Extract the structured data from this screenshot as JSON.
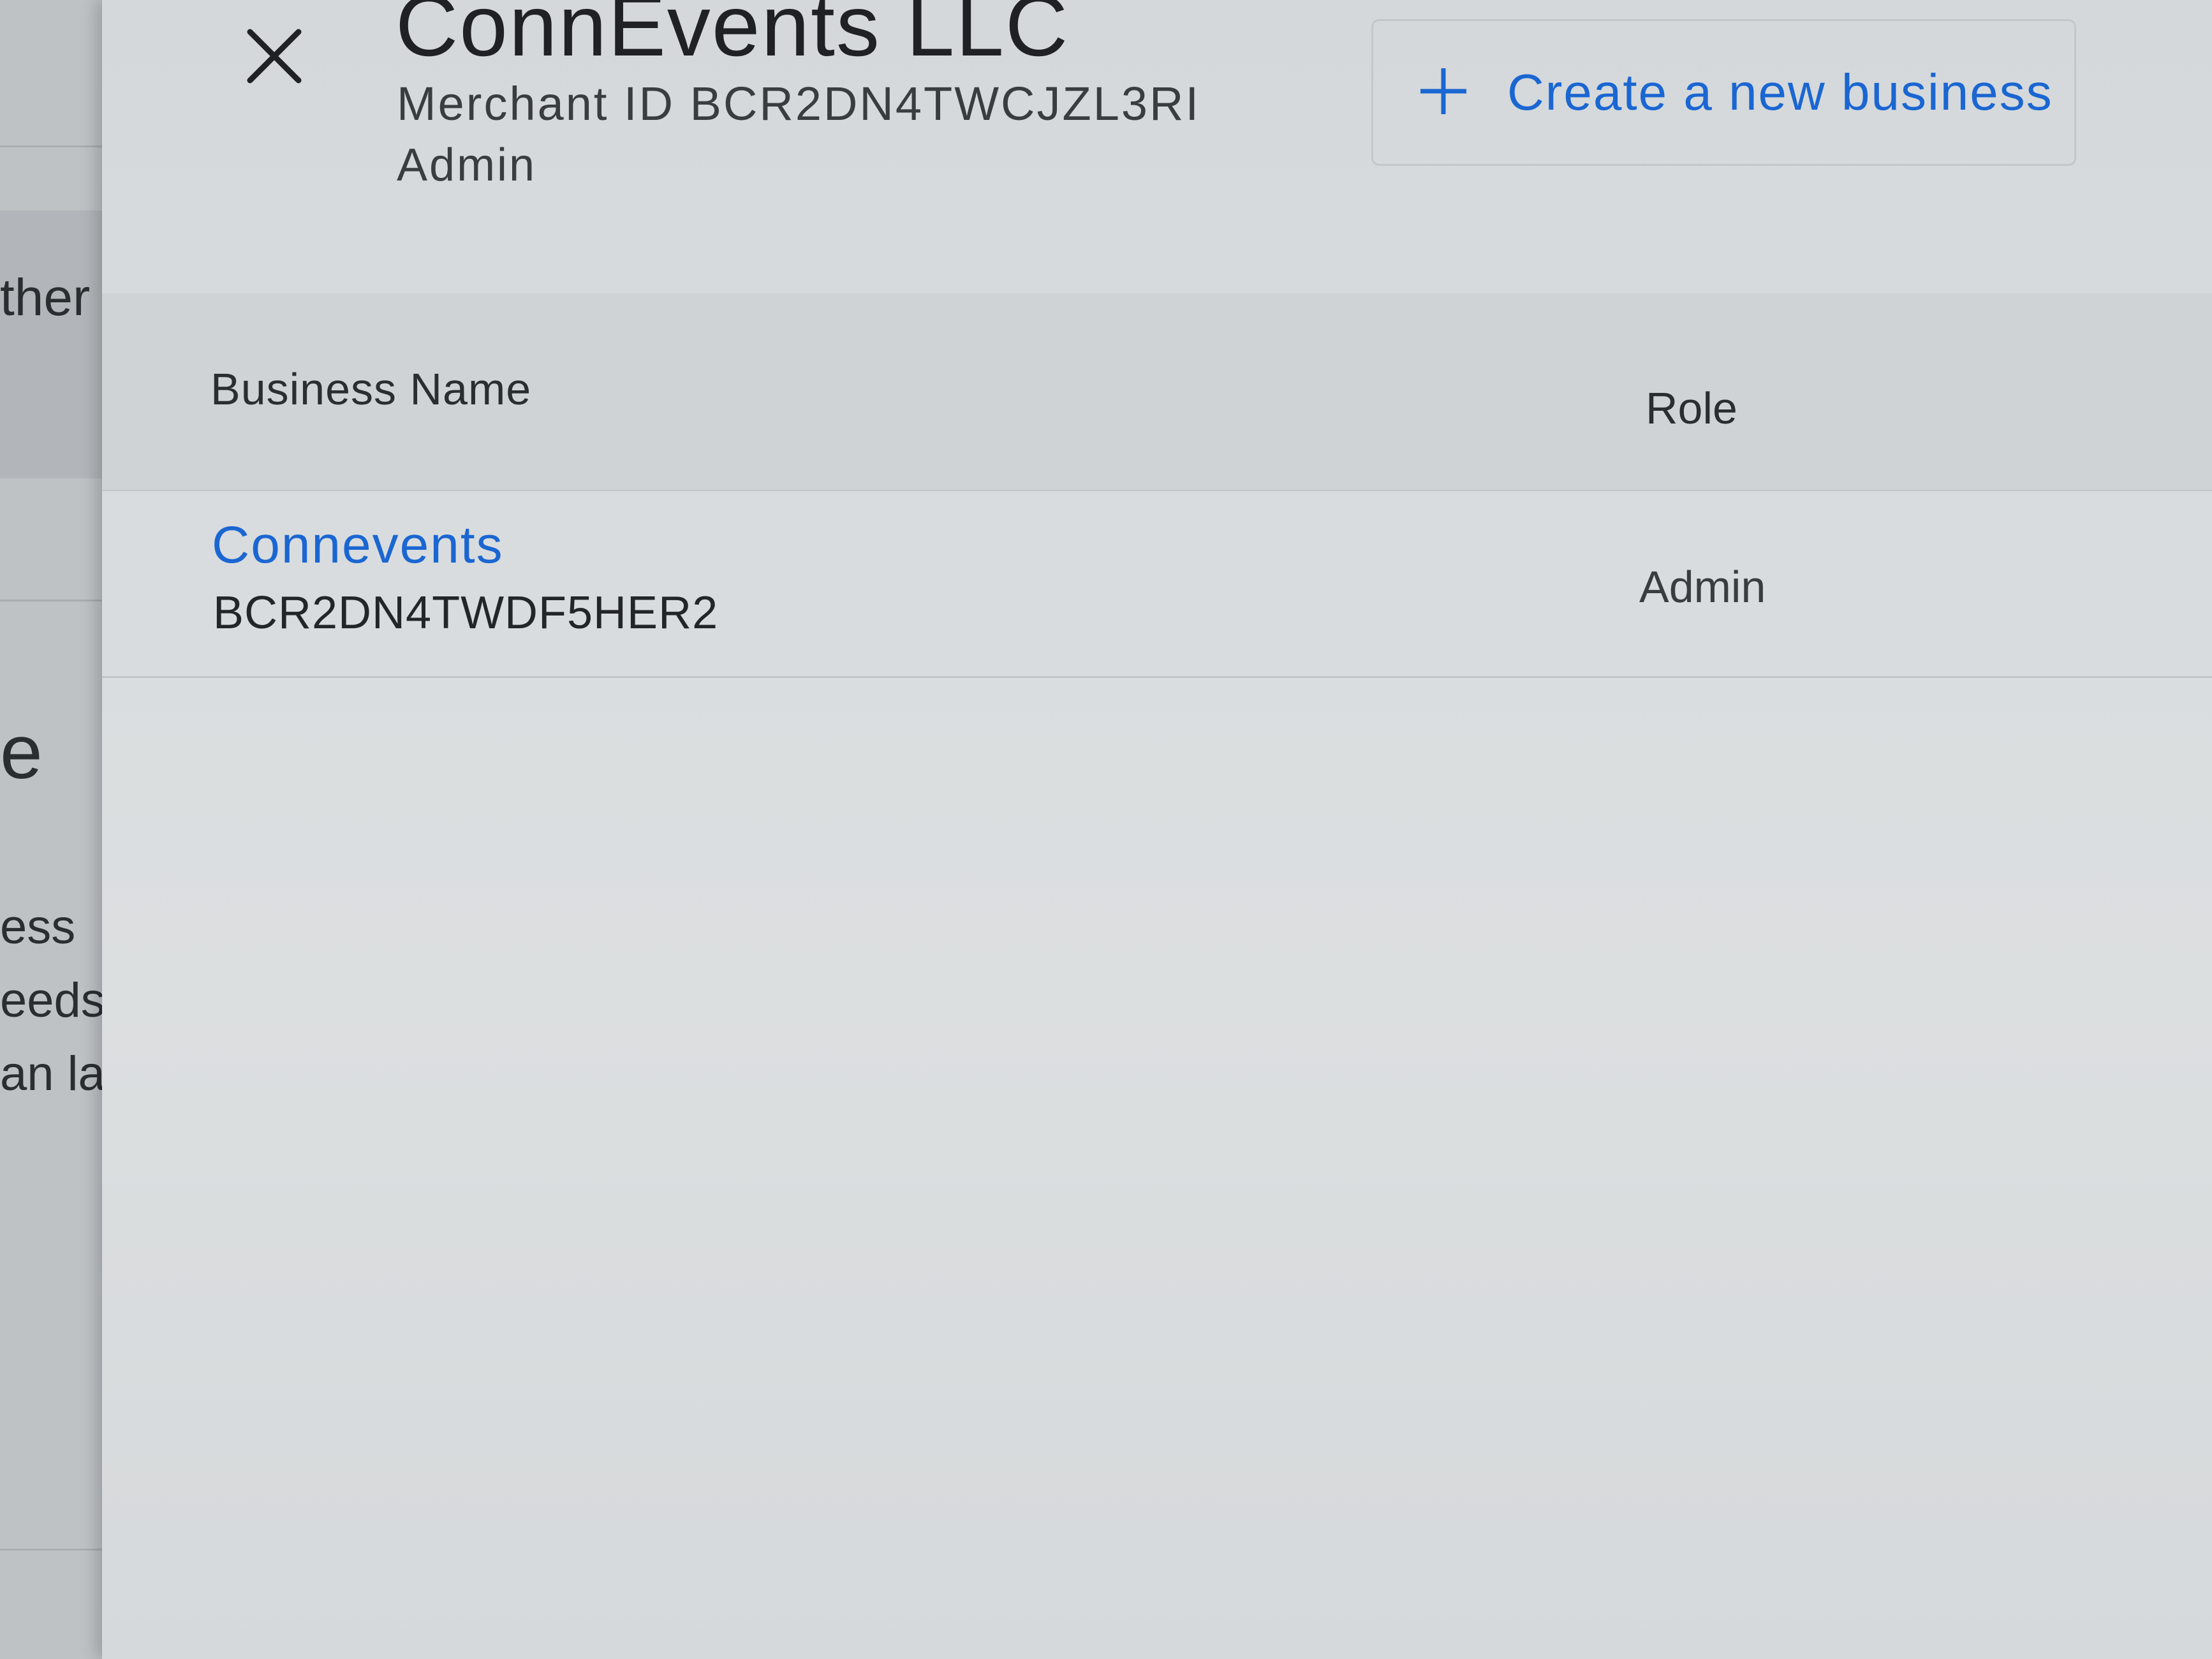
{
  "background_page": {
    "text_fragments": [
      "ther",
      "e",
      "ess",
      "eeds t",
      "an lau"
    ]
  },
  "drawer": {
    "close_icon": "close-icon",
    "title": "ConnEvents LLC",
    "merchant_id": "Merchant ID BCR2DN4TWCJZL3RI",
    "role": "Admin",
    "create_button": {
      "icon": "plus-icon",
      "label": "Create a new business"
    },
    "table": {
      "columns": [
        "Business Name",
        "Role"
      ],
      "rows": [
        {
          "name": "Connevents",
          "id": "BCR2DN4TWDF5HER2",
          "role": "Admin"
        }
      ]
    }
  },
  "colors": {
    "accent": "#1a66d2",
    "text": "#2b2e31"
  }
}
